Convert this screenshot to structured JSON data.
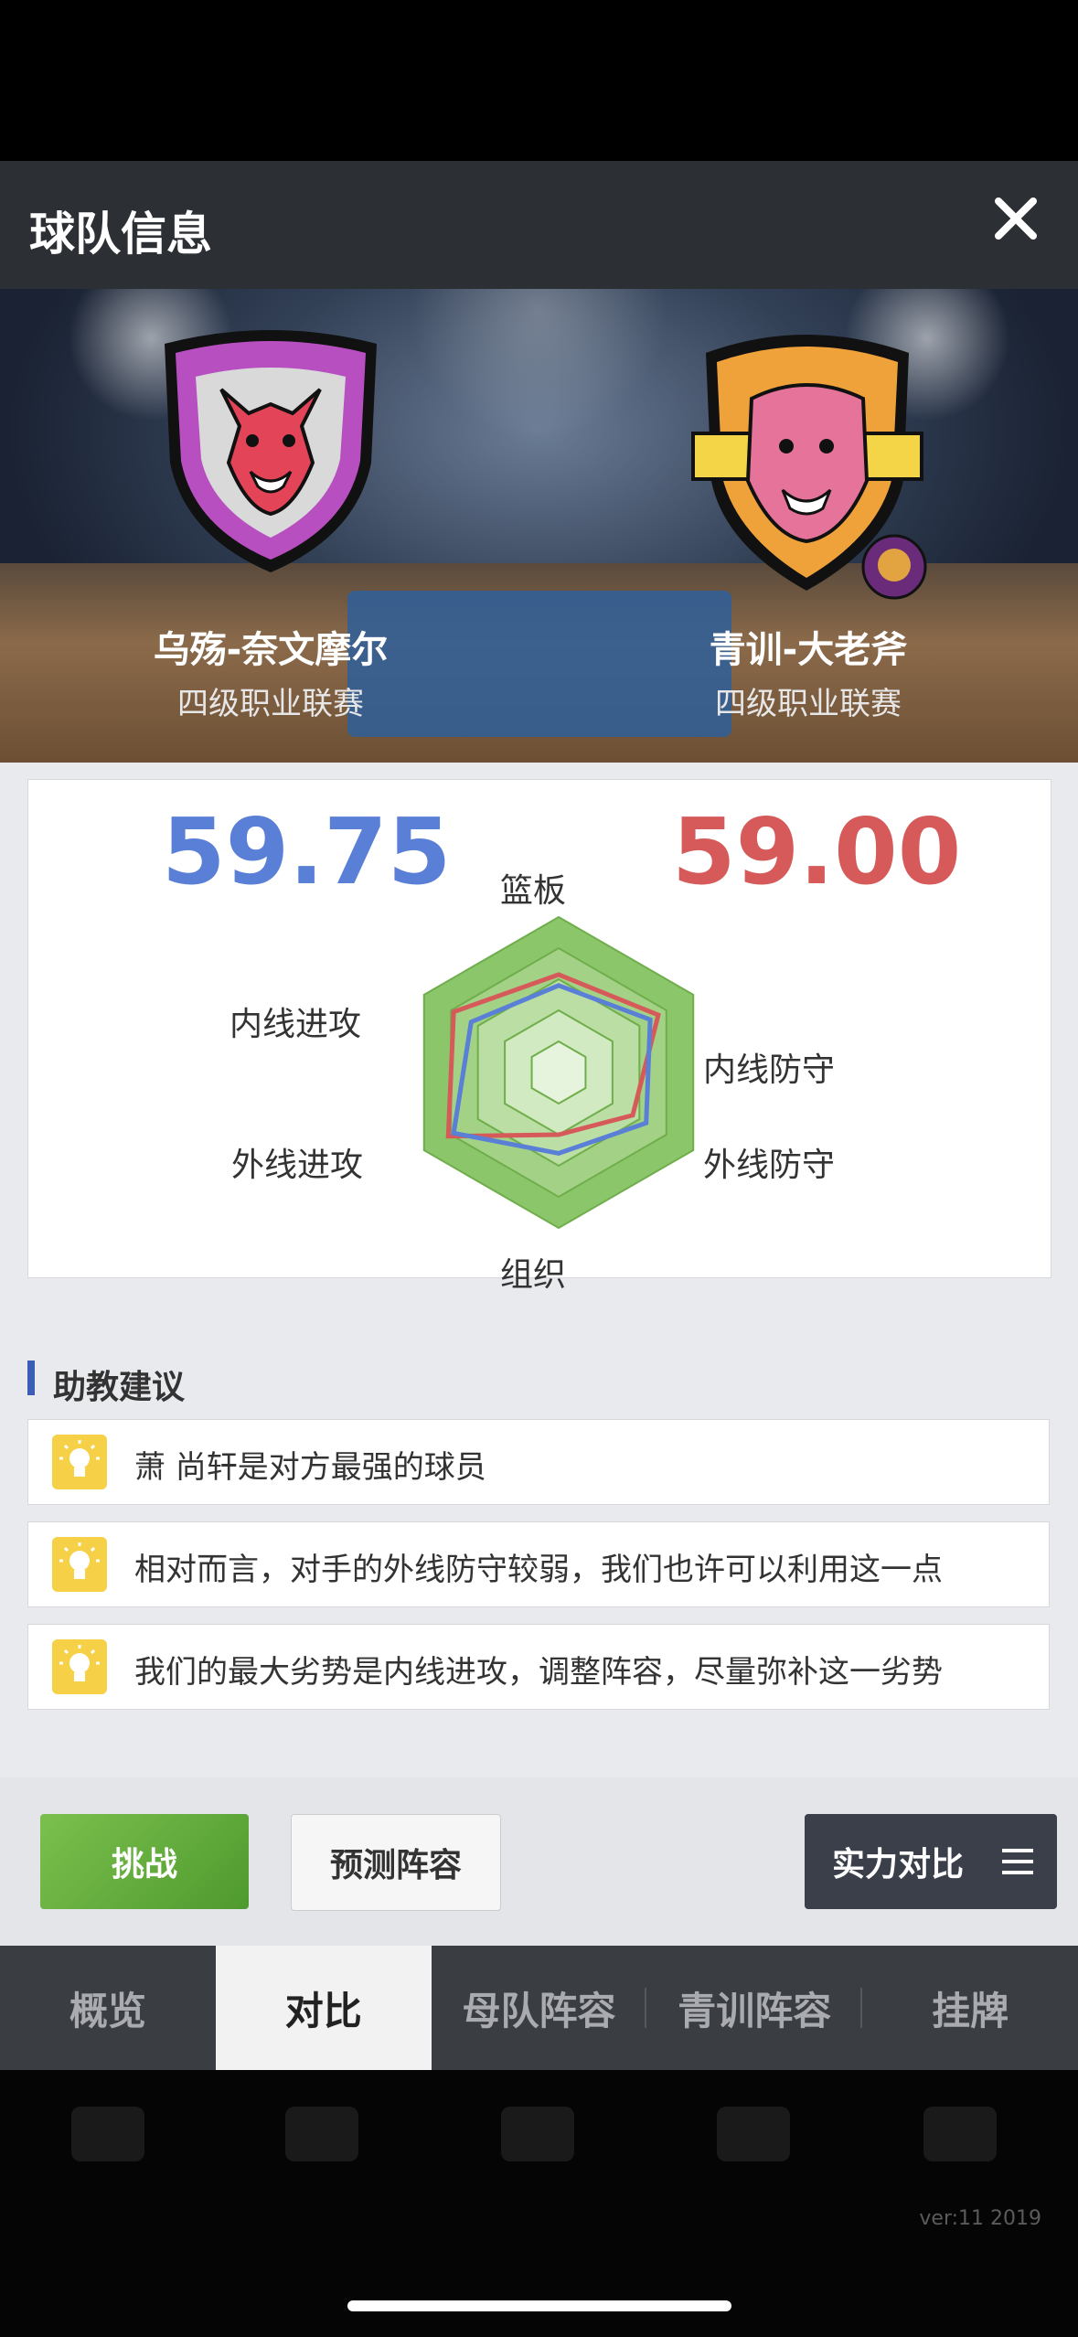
{
  "header": {
    "title": "球队信息"
  },
  "teams": {
    "home": {
      "name": "乌殇-奈文摩尔",
      "league": "四级职业联赛",
      "score": "59.75",
      "color": "#5a7fd6"
    },
    "away": {
      "name": "青训-大老斧",
      "league": "四级职业联赛",
      "score": "59.00",
      "color": "#d65a5a"
    }
  },
  "radar": {
    "axes": [
      "篮板",
      "内线防守",
      "外线防守",
      "组织",
      "外线进攻",
      "内线进攻"
    ],
    "home_values": [
      0.56,
      0.68,
      0.65,
      0.52,
      0.78,
      0.65
    ],
    "away_values": [
      0.63,
      0.74,
      0.55,
      0.4,
      0.82,
      0.78
    ]
  },
  "advice": {
    "title": "助教建议",
    "tips": [
      "萧 尚轩是对方最强的球员",
      "相对而言，对手的外线防守较弱，我们也许可以利用这一点",
      "我们的最大劣势是内线进攻，调整阵容，尽量弥补这一劣势"
    ]
  },
  "actions": {
    "challenge": "挑战",
    "predict": "预测阵容",
    "compare": "实力对比"
  },
  "tabs": [
    "概览",
    "对比",
    "母队阵容",
    "青训阵容",
    "挂牌"
  ],
  "active_tab": 1,
  "version": "ver:11 2019",
  "icons": {
    "close": "close-icon",
    "bulb": "lightbulb-icon",
    "menu": "hamburger-menu-icon"
  }
}
